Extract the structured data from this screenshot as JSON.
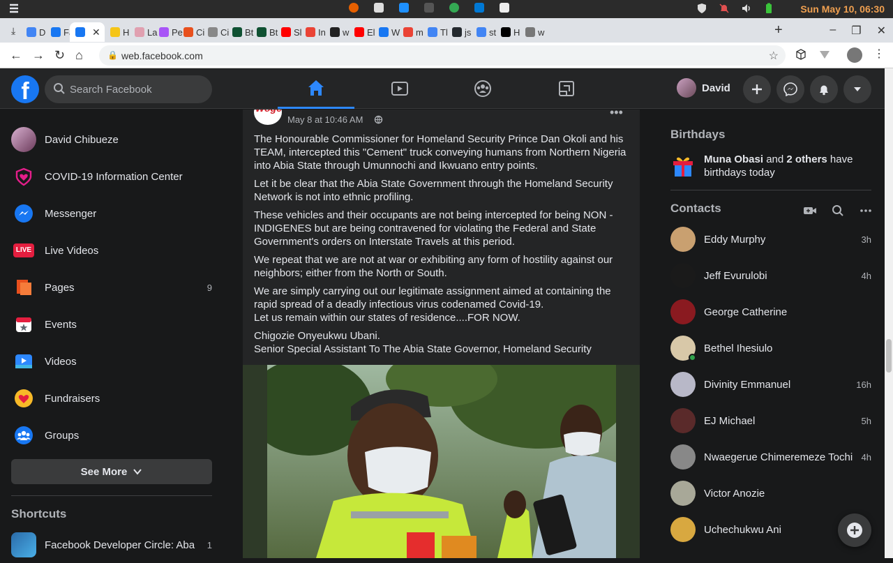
{
  "os": {
    "clock": "Sun May 10, 06:30"
  },
  "browser": {
    "tabs": [
      {
        "label": "D",
        "color": "#4285f4"
      },
      {
        "label": "Fa",
        "color": "#1877f2"
      },
      {
        "label": "",
        "color": "#1877f2",
        "active": true
      },
      {
        "label": "H",
        "color": "#f5c518"
      },
      {
        "label": "La",
        "color": "#e0a0b0"
      },
      {
        "label": "Pe",
        "color": "#a855f7"
      },
      {
        "label": "Ci",
        "color": "#e8501d"
      },
      {
        "label": "Ci",
        "color": "#888888"
      },
      {
        "label": "Bt",
        "color": "#0f5132"
      },
      {
        "label": "Bt",
        "color": "#0f5132"
      },
      {
        "label": "Sl",
        "color": "#ff0000"
      },
      {
        "label": "In",
        "color": "#ea4335"
      },
      {
        "label": "w",
        "color": "#222222"
      },
      {
        "label": "El",
        "color": "#ff0000"
      },
      {
        "label": "W",
        "color": "#1877f2"
      },
      {
        "label": "m",
        "color": "#ea4335"
      },
      {
        "label": "Tl",
        "color": "#4285f4"
      },
      {
        "label": "js",
        "color": "#24292e"
      },
      {
        "label": "st",
        "color": "#4285f4"
      },
      {
        "label": "H",
        "color": "#000000"
      },
      {
        "label": "w",
        "color": "#777777"
      }
    ],
    "url": "web.facebook.com"
  },
  "header": {
    "logo": "f",
    "search_placeholder": "Search Facebook",
    "profile_name": "David"
  },
  "left_nav": {
    "items": [
      {
        "label": "David Chibueze",
        "icon": "avatar"
      },
      {
        "label": "COVID-19 Information Center",
        "icon": "covid-heart-icon"
      },
      {
        "label": "Messenger",
        "icon": "messenger-icon"
      },
      {
        "label": "Live Videos",
        "icon": "live-icon",
        "badge_text": "LIVE"
      },
      {
        "label": "Pages",
        "icon": "pages-flag-icon",
        "count": "9"
      },
      {
        "label": "Events",
        "icon": "events-calendar-icon"
      },
      {
        "label": "Videos",
        "icon": "videos-play-icon"
      },
      {
        "label": "Fundraisers",
        "icon": "fundraisers-heart-icon"
      },
      {
        "label": "Groups",
        "icon": "groups-icon"
      }
    ],
    "see_more": "See More",
    "shortcuts_title": "Shortcuts",
    "shortcuts": [
      {
        "label": "Facebook Developer Circle: Aba",
        "count": "1"
      }
    ]
  },
  "post": {
    "date": "May 8 at 10:46 AM",
    "separator": "·",
    "paragraphs": [
      "The Honourable Commissioner for Homeland Security Prince Dan Okoli and his TEAM, intercepted this \"Cement\" truck conveying humans from Northern Nigeria into Abia State through Umunnochi and Ikwuano entry points.",
      "Let it be clear that the Abia State Government through the Homeland Security Network is not into ethnic profiling.",
      "These vehicles and their occupants are not being intercepted for being NON - INDIGENES but are being contravened for violating the Federal and State Government's orders on Interstate Travels at this period.",
      "We repeat that we are not at war or exhibiting any form of hostility against our neighbors; either from the North or South.",
      "We are simply carrying out our legitimate assignment aimed at containing the rapid spread of a deadly infectious virus codenamed Covid-19.",
      "Let us remain within our states of residence....FOR NOW.",
      "Chigozie Onyeukwu Ubani.",
      "Senior Special Assistant To The Abia State Governor, Homeland Security"
    ]
  },
  "right": {
    "birthdays_title": "Birthdays",
    "birthday_name": "Muna Obasi",
    "birthday_and": "and",
    "birthday_others": "2 others",
    "birthday_rest": "have birthdays today",
    "contacts_title": "Contacts",
    "contacts": [
      {
        "name": "Eddy Murphy",
        "time": "3h",
        "color": "#c9a070"
      },
      {
        "name": "Jeff Evurulobi",
        "time": "4h",
        "color": "#1a1a1a"
      },
      {
        "name": "George Catherine",
        "time": "",
        "color": "#8a1a20"
      },
      {
        "name": "Bethel Ihesiulo",
        "time": "",
        "color": "#d8c8a8",
        "online": true
      },
      {
        "name": "Divinity Emmanuel",
        "time": "16h",
        "color": "#b8b8c8"
      },
      {
        "name": "EJ Michael",
        "time": "5h",
        "color": "#5a2a2a"
      },
      {
        "name": "Nwaegerue Chimeremeze Tochi",
        "time": "4h",
        "color": "#888888"
      },
      {
        "name": "Victor Anozie",
        "time": "",
        "color": "#a8a898"
      },
      {
        "name": "Uchechukwu Ani",
        "time": "",
        "color": "#d8a840"
      }
    ]
  }
}
